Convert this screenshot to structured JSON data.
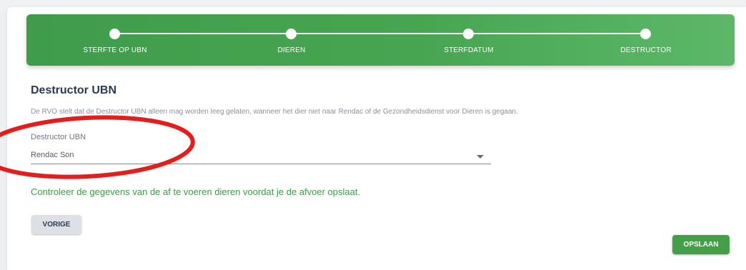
{
  "stepper": {
    "steps": [
      {
        "label": "STERFTE OP UBN"
      },
      {
        "label": "DIEREN"
      },
      {
        "label": "STERFDATUM"
      },
      {
        "label": "DESTRUCTOR"
      }
    ]
  },
  "section": {
    "title": "Destructor UBN",
    "help_text": "De RVO stelt dat de Destructor UBN alleen mag worden leeg gelaten, wanneer het dier niet naar Rendac of de Gezondheidsdienst voor Dieren is gegaan."
  },
  "destructor_field": {
    "label": "Destructor UBN",
    "value": "Rendac Son"
  },
  "notice": "Controleer de gegevens van de af te voeren dieren voordat je de afvoer opslaat.",
  "buttons": {
    "previous": "VORIGE",
    "save": "OPSLAAN"
  },
  "colors": {
    "accent": "#47a552",
    "annotation": "#e41d1d"
  }
}
